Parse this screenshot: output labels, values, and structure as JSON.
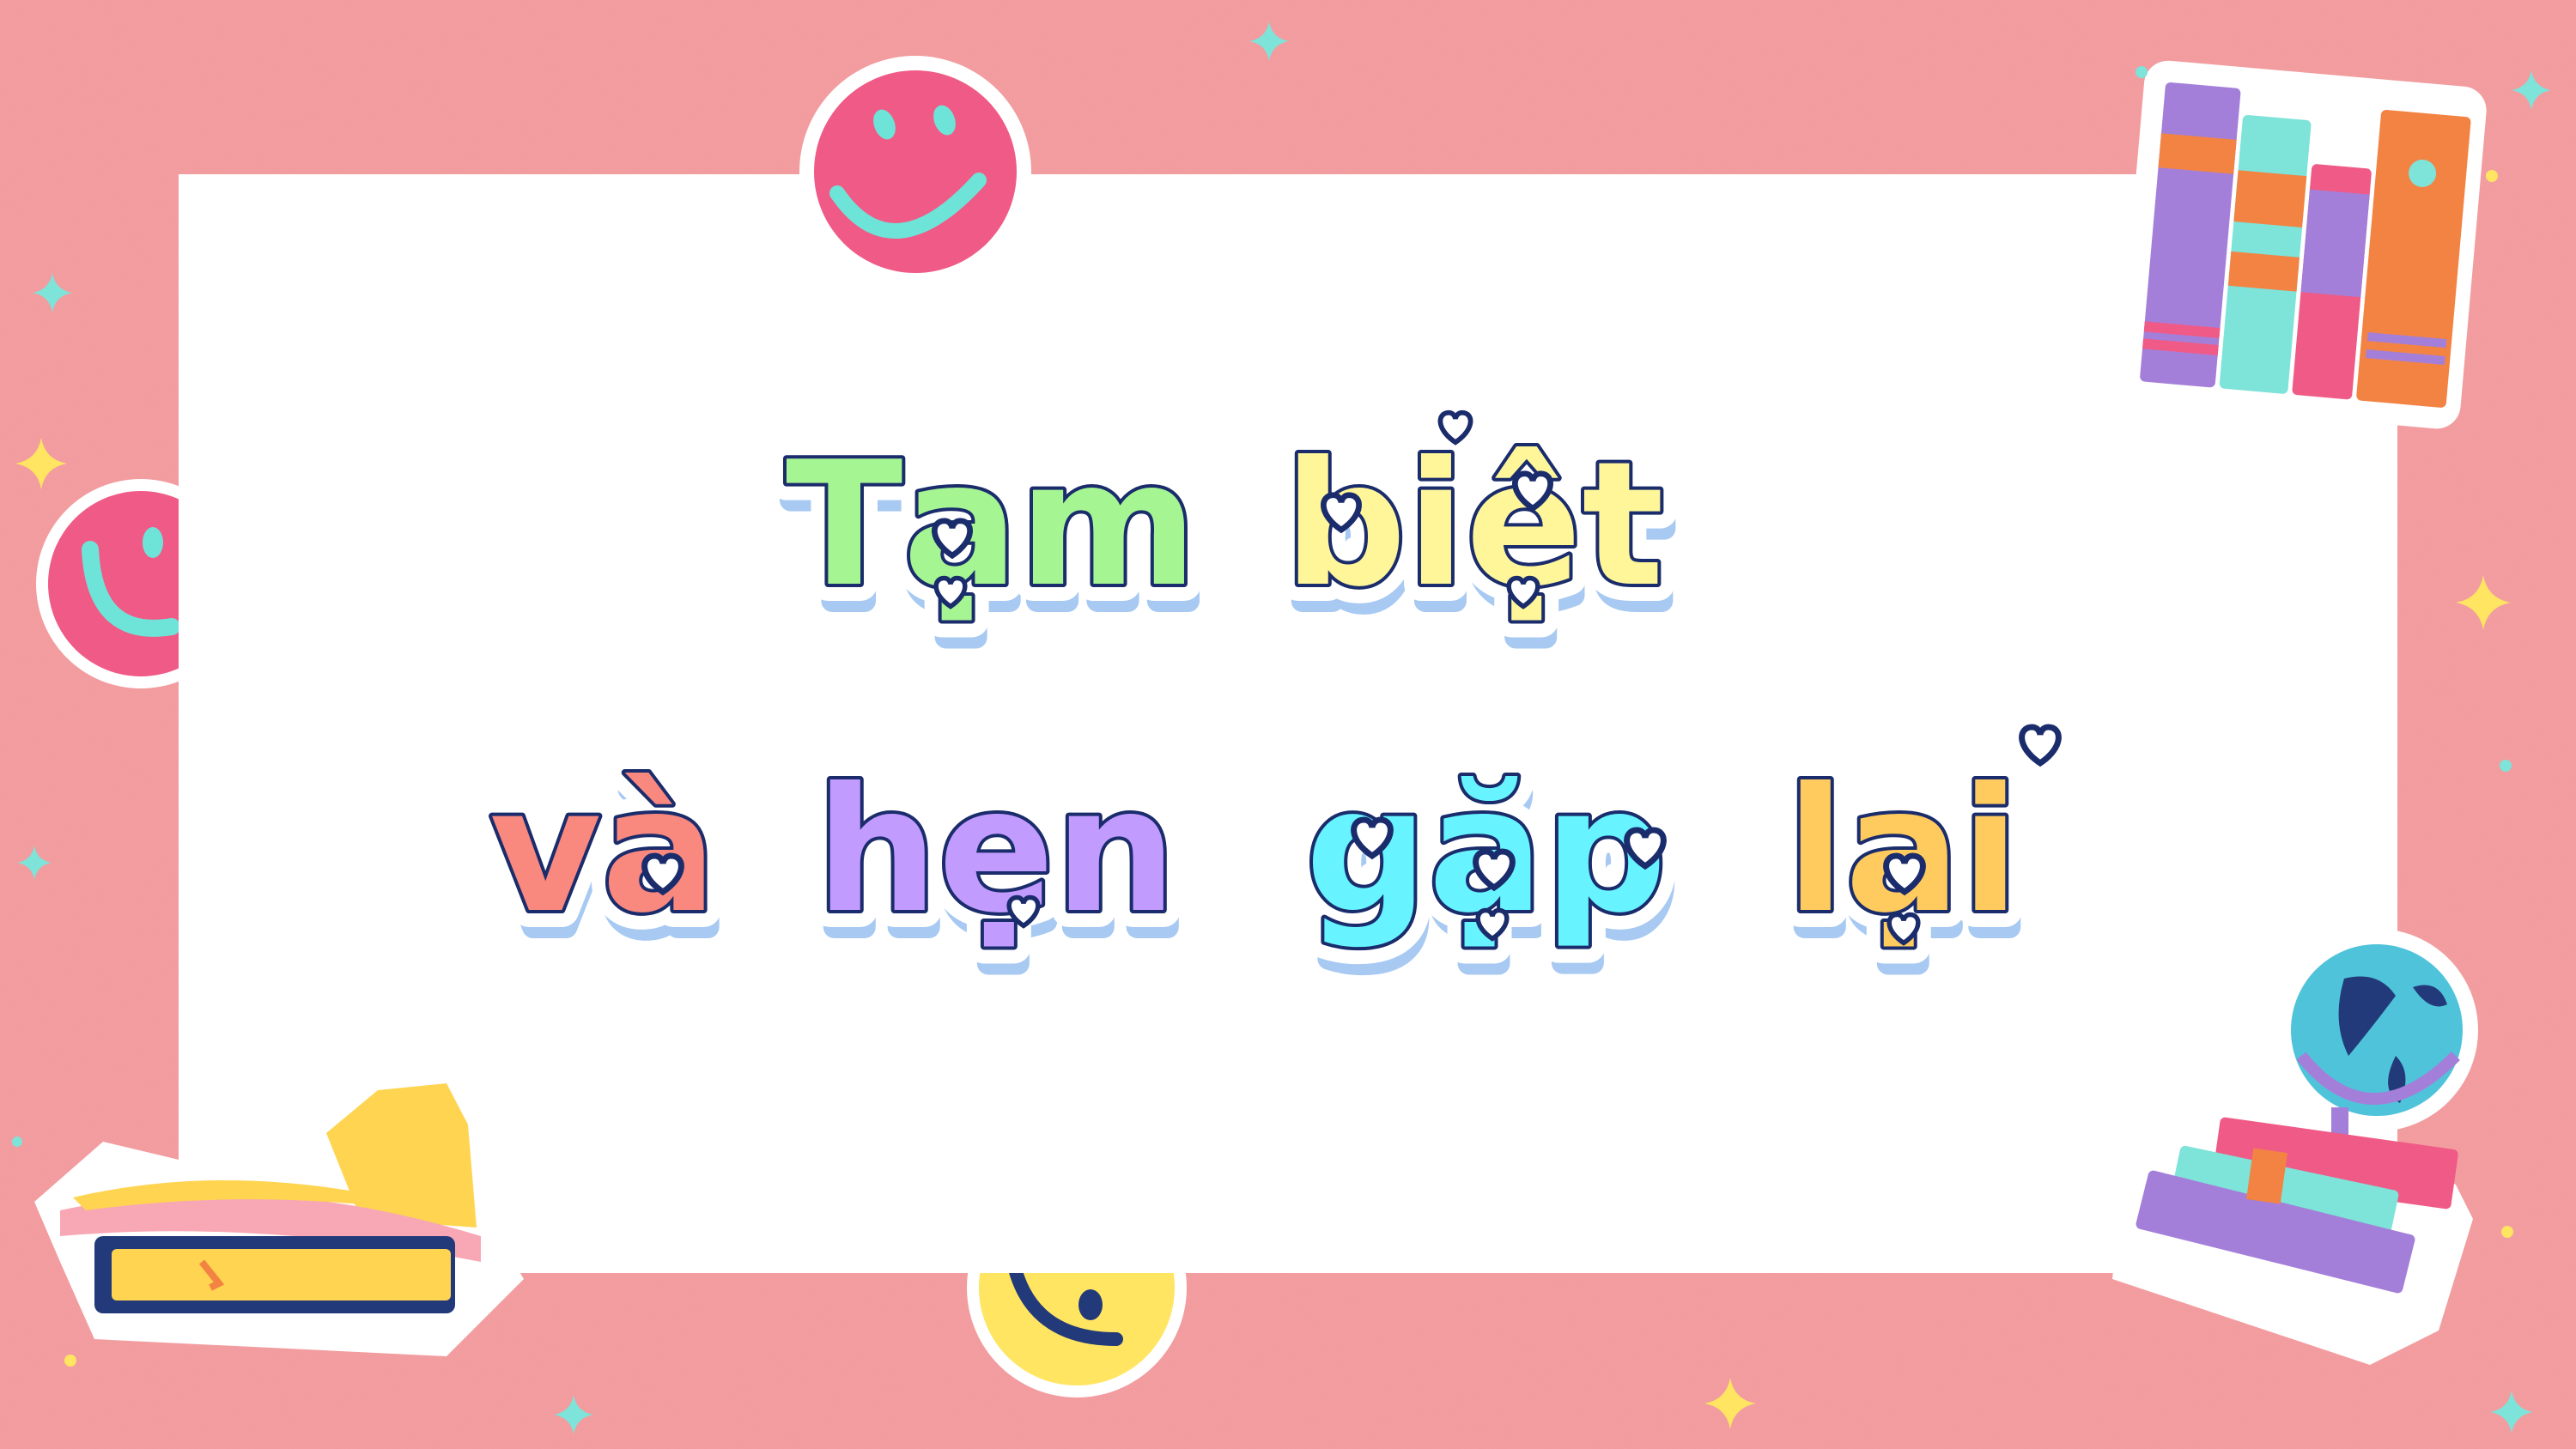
{
  "slide": {
    "background": "#F49C9F",
    "card": "#FFFFFF",
    "line1": [
      {
        "text": "Tạm",
        "color": "#A6F593"
      },
      {
        "text": "biệt",
        "color": "#FFF69A"
      }
    ],
    "line2": [
      {
        "text": "và",
        "color": "#F9887F"
      },
      {
        "text": "hẹn",
        "color": "#C29BFF"
      },
      {
        "text": "gặp",
        "color": "#67F3FF"
      },
      {
        "text": "lại",
        "color": "#FFCB5E"
      }
    ],
    "outline_color": "#1A2C6B",
    "decorations": [
      "smiley-face-sticker",
      "smiley-face-sticker",
      "smiley-face-sticker",
      "book-stack-icon",
      "open-book-icon",
      "globe-icon",
      "sparkle-icon"
    ]
  }
}
